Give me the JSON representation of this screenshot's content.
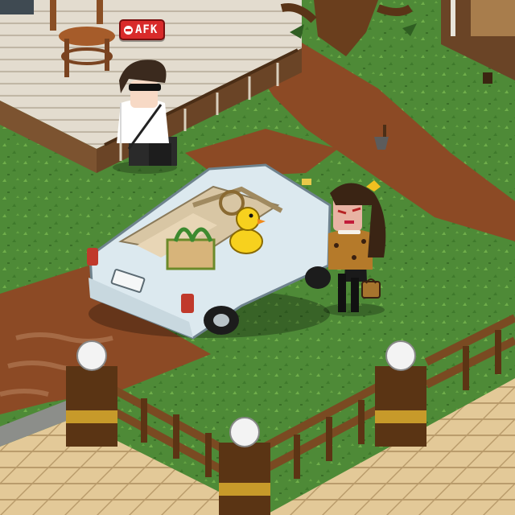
{
  "scene": {
    "status_badge": {
      "text": "AFK",
      "icon": "minus-circle-icon"
    },
    "car_plate": {
      "text": ""
    }
  },
  "colors": {
    "grass": "#4e8a37",
    "dirt_path": "#8c4a25",
    "deck_wood": "#e2dbcd",
    "car_body": "#dce9ef",
    "fence_wood": "#7a4a22",
    "lamp_globe": "#f3f3f3",
    "afk_badge": "#d92a2a"
  }
}
